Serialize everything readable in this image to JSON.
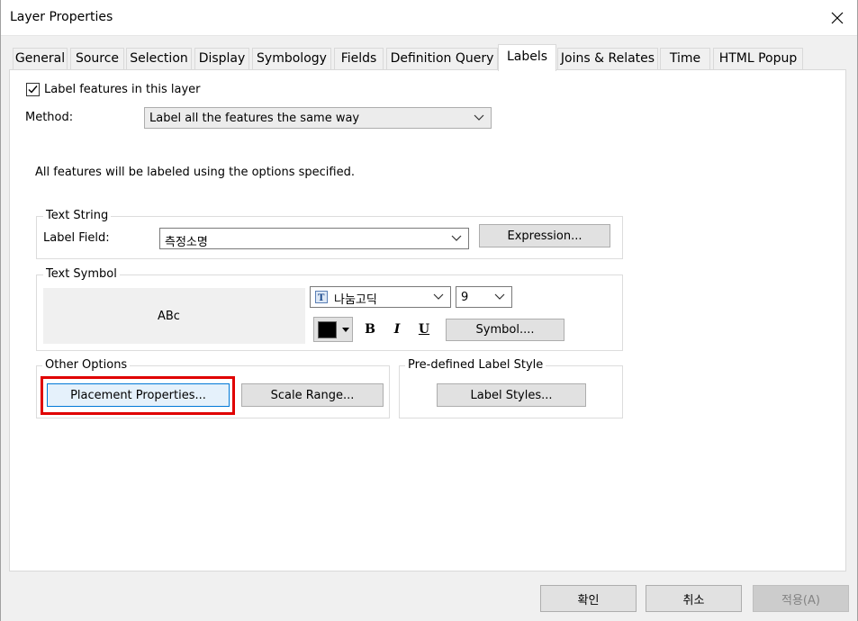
{
  "window": {
    "title": "Layer Properties",
    "close_glyph": "✕"
  },
  "tabs": [
    {
      "label": "General"
    },
    {
      "label": "Source"
    },
    {
      "label": "Selection"
    },
    {
      "label": "Display"
    },
    {
      "label": "Symbology"
    },
    {
      "label": "Fields"
    },
    {
      "label": "Definition Query"
    },
    {
      "label": "Labels",
      "active": true
    },
    {
      "label": "Joins & Relates"
    },
    {
      "label": "Time"
    },
    {
      "label": "HTML Popup"
    }
  ],
  "labels_tab": {
    "label_features_checkbox": {
      "label": "Label features in this layer",
      "checked": true
    },
    "method": {
      "label": "Method:",
      "value": "Label all the features the same way"
    },
    "info_text": "All features will be labeled using the options specified.",
    "text_string": {
      "legend": "Text String",
      "label_field_label": "Label Field:",
      "label_field_value": "측정소명",
      "expression_button": "Expression..."
    },
    "text_symbol": {
      "legend": "Text Symbol",
      "preview_text": "ABc",
      "font_icon": "truetype-font-icon",
      "font_value": "나눔고딕",
      "size_value": "9",
      "color_value": "#000000",
      "bold_label": "B",
      "italic_label": "I",
      "underline_label": "U",
      "symbol_button": "Symbol...."
    },
    "other_options": {
      "legend": "Other Options",
      "placement_button": "Placement Properties...",
      "scale_range_button": "Scale Range..."
    },
    "predefined_style": {
      "legend": "Pre-defined Label Style",
      "label_styles_button": "Label Styles..."
    }
  },
  "footer": {
    "ok_button": "확인",
    "cancel_button": "취소",
    "apply_button": "적용(A)"
  },
  "colors": {
    "highlight": "#e00000",
    "focus_border": "#0078d7",
    "focus_fill": "#e5f1fb"
  }
}
